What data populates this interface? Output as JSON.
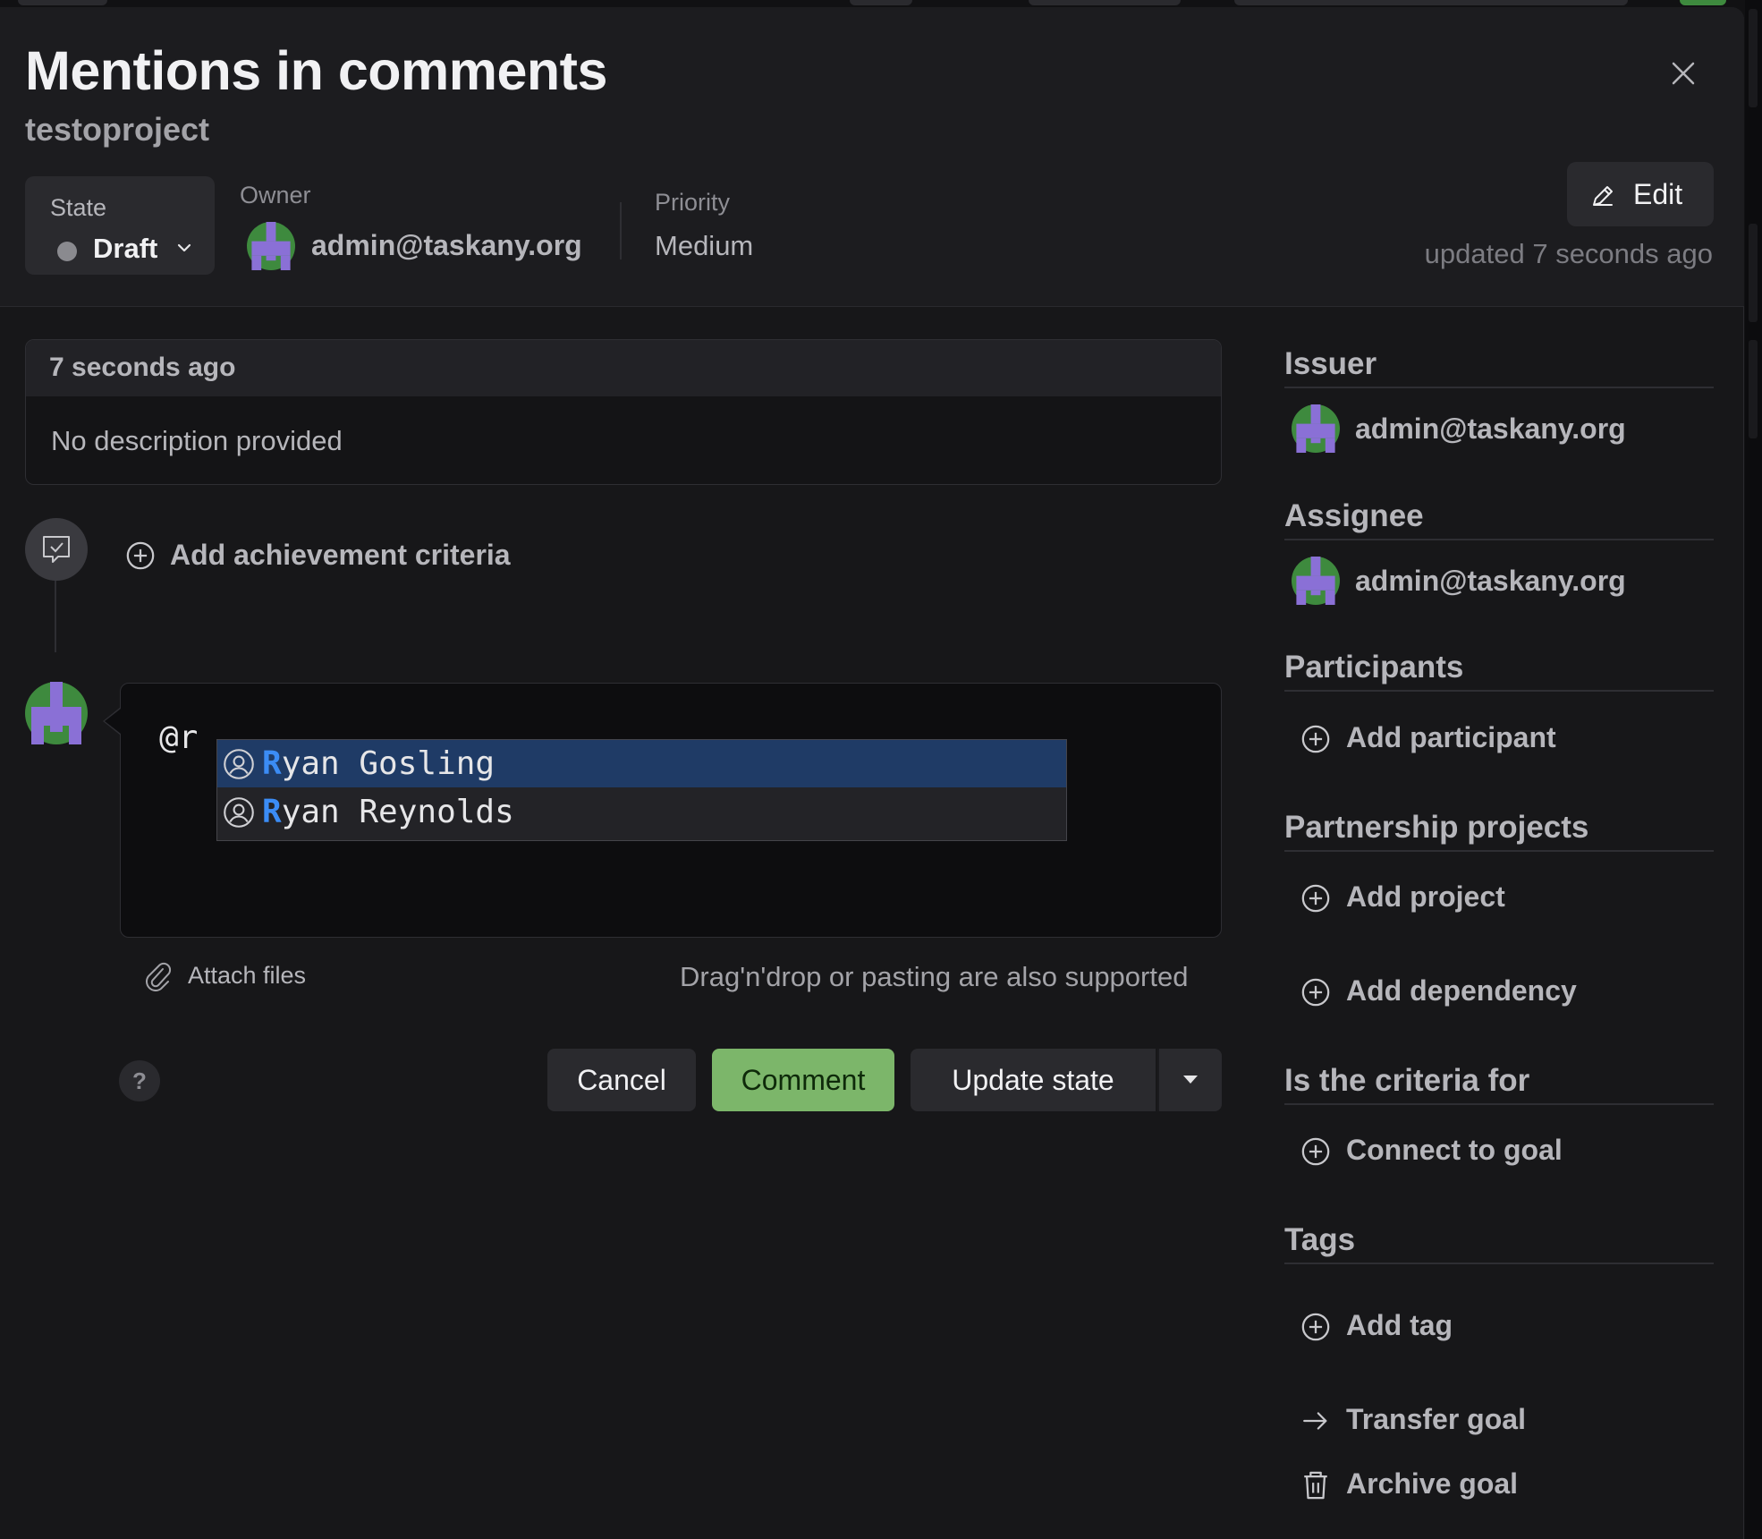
{
  "header": {
    "title": "Mentions in comments",
    "project": "testoproject",
    "state": {
      "label": "State",
      "value": "Draft"
    },
    "owner": {
      "label": "Owner",
      "value": "admin@taskany.org"
    },
    "priority": {
      "label": "Priority",
      "value": "Medium"
    },
    "edit_label": "Edit",
    "updated": "updated 7 seconds ago"
  },
  "description": {
    "time": "7 seconds ago",
    "text": "No description provided"
  },
  "timeline": {
    "add_criteria": "Add achievement criteria"
  },
  "comment": {
    "input_value": "@r",
    "mentions": [
      "Ryan Gosling",
      "Ryan Reynolds"
    ],
    "attach_label": "Attach files",
    "dnd_hint": "Drag'n'drop or pasting are also supported",
    "help_label": "?",
    "cancel_label": "Cancel",
    "comment_label": "Comment",
    "update_state_label": "Update state"
  },
  "sidebar": {
    "issuer": {
      "heading": "Issuer",
      "user": "admin@taskany.org"
    },
    "assignee": {
      "heading": "Assignee",
      "user": "admin@taskany.org"
    },
    "participants": {
      "heading": "Participants",
      "action": "Add participant"
    },
    "partnership": {
      "heading": "Partnership projects",
      "action": "Add project",
      "action2": "Add dependency"
    },
    "criteria_for": {
      "heading": "Is the criteria for",
      "action": "Connect to goal"
    },
    "tags": {
      "heading": "Tags",
      "action": "Add tag"
    },
    "transfer": "Transfer goal",
    "archive": "Archive goal"
  },
  "colors": {
    "background": "#171719",
    "accent_green": "#7cb66a",
    "mention_highlight": "#1f3b66",
    "mention_match": "#3b8cf5",
    "avatar_green": "#3e8a3e",
    "avatar_purple": "#8a70d6"
  },
  "icons": [
    "close-icon",
    "chevron-down-icon",
    "pencil-icon",
    "comment-check-icon",
    "plus-circle-icon",
    "user-circle-icon",
    "paperclip-icon",
    "caret-down-icon",
    "arrow-right-icon",
    "archive-icon"
  ]
}
